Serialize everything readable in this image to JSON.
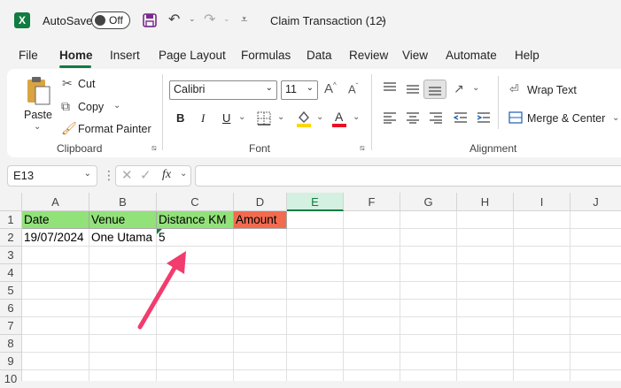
{
  "titlebar": {
    "autosave_label": "AutoSave",
    "autosave_state": "Off",
    "document_title": "Claim Transaction (12)"
  },
  "menu": [
    "File",
    "Home",
    "Insert",
    "Page Layout",
    "Formulas",
    "Data",
    "Review",
    "View",
    "Automate",
    "Help"
  ],
  "ribbon": {
    "clipboard": {
      "paste": "Paste",
      "cut": "Cut",
      "copy": "Copy",
      "format_painter": "Format Painter",
      "label": "Clipboard"
    },
    "font": {
      "font_name": "Calibri",
      "font_size": "11",
      "label": "Font",
      "bold": "B",
      "italic": "I",
      "underline": "U"
    },
    "alignment": {
      "wrap_text": "Wrap Text",
      "merge_center": "Merge & Center",
      "label": "Alignment"
    }
  },
  "formula_bar": {
    "name_box": "E13",
    "fx": "fx",
    "formula": ""
  },
  "sheet": {
    "columns": [
      "A",
      "B",
      "C",
      "D",
      "E",
      "F",
      "G",
      "H",
      "I",
      "J"
    ],
    "selected_column": "E",
    "rows": [
      "1",
      "2",
      "3",
      "4",
      "5",
      "6",
      "7",
      "8",
      "9",
      "10"
    ],
    "header_row": [
      "Date",
      "Venue",
      "Distance KM",
      "Amount"
    ],
    "data_row": [
      "19/07/2024",
      "One Utama",
      "5",
      ""
    ],
    "colors": {
      "header_green": "#92e27a",
      "header_red": "#f26b4f",
      "annotation_arrow": "#f23c6e",
      "accent": "#107c41"
    }
  }
}
